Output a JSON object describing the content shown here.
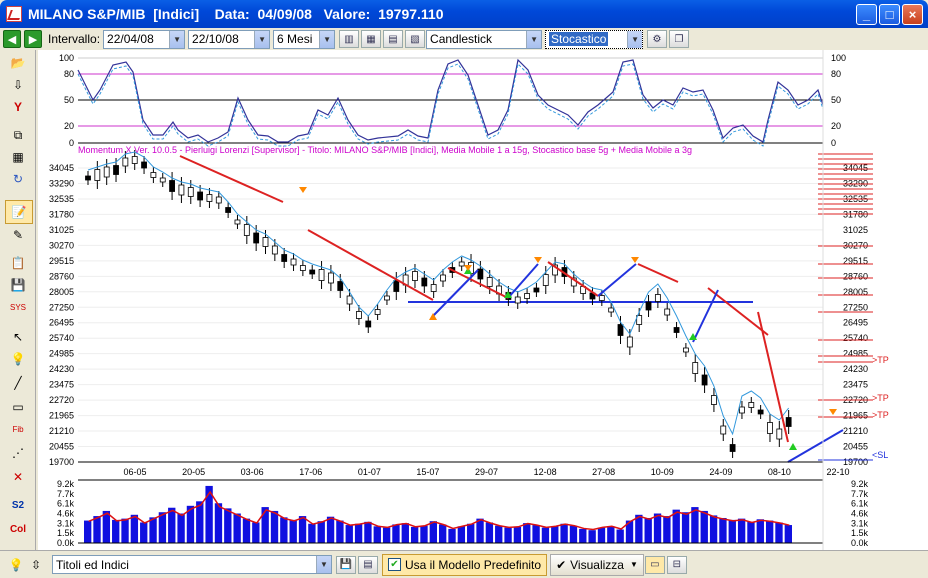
{
  "window": {
    "title": "MILANO S&P/MIB  [Indici]    Data:  04/09/08   Valore:  19797.110",
    "buttons": {
      "minimize": "_",
      "maximize": "□",
      "close": "×"
    }
  },
  "toolbar": {
    "interval_label": "Intervallo:",
    "date_from": "22/04/08",
    "date_to": "22/10/08",
    "period": "6 Mesi",
    "chart_type": "Candlestick",
    "indicator": "Stocastico"
  },
  "chart": {
    "info_text": "Momentum X   Ver. 10.0.5  -  Pierluigi Lorenzi  [Supervisor]  - Titolo: MILANO S&P/MIB  [Indici],   Media Mobile 1 a 15g,   Stocastico base 5g + Media Mobile a 3g",
    "colors": {
      "grid_magenta": "#cc33cc",
      "candle": "#000000",
      "ma": "#3399dd",
      "trend_red": "#dd2222",
      "trend_blue": "#2233dd",
      "volume_bar": "#1010e0",
      "volume_ma": "#dd1111"
    },
    "stoch_ticks": [
      "100",
      "80",
      "50",
      "20",
      "0"
    ],
    "price_ticks": [
      "34045",
      "33290",
      "32535",
      "31780",
      "31025",
      "30270",
      "29515",
      "28760",
      "28005",
      "27250",
      "26495",
      "25740",
      "24985",
      "24230",
      "23475",
      "22720",
      "21965",
      "21210",
      "20455",
      "19700"
    ],
    "date_ticks": [
      "06-05",
      "20-05",
      "03-06",
      "17-06",
      "01-07",
      "15-07",
      "29-07",
      "12-08",
      "27-08",
      "10-09",
      "24-09",
      "08-10",
      "22-10"
    ],
    "volume_ticks": [
      "9.2k",
      "7.7k",
      "6.1k",
      "4.6k",
      "3.1k",
      "1.5k",
      "0.0k"
    ],
    "tp_labels": [
      ">TP",
      ">TP",
      ">TP"
    ],
    "sl_label": "<SL"
  },
  "statusbar": {
    "list_name": "Titoli ed Indici",
    "use_default_model": "Usa il Modello Predefinito",
    "view_label": "Visualizza"
  }
}
